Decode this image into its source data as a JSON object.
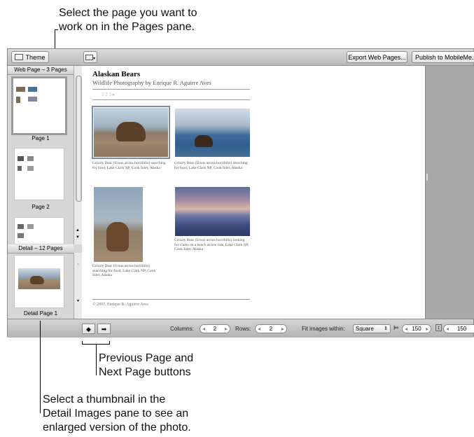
{
  "callouts": {
    "top_line1": "Select the page you want to",
    "top_line2": "work on in the Pages pane.",
    "nav_line1": "Previous Page and",
    "nav_line2": "Next Page buttons",
    "detail_line1": "Select a thumbnail in the",
    "detail_line2": "Detail Images pane to see an",
    "detail_line3": "enlarged version of the photo."
  },
  "toolbar": {
    "theme_label": "Theme",
    "export_label": "Export Web Pages...",
    "publish_label": "Publish to MobileMe..."
  },
  "pages_pane": {
    "header": "Web Page – 3 Pages",
    "items": [
      {
        "label": "Page 1"
      },
      {
        "label": "Page 2"
      }
    ]
  },
  "detail_pane": {
    "header": "Detail – 12 Pages",
    "items": [
      {
        "label": "Detail Page 1"
      }
    ]
  },
  "page": {
    "title": "Alaskan Bears",
    "subtitle": "Wildlife Photography by Enrique R. Aguirre Aves",
    "pagenav": "1 2 3 ▸",
    "footer": "© 2007, Enrique R. Aguirre Aves",
    "captions": [
      "Grizzly Bear (Ursus arctos horribilis) searching for food, Lake Clark NP, Cook Inlet, Alaska",
      "Grizzly Bear (Ursus arctos horribilis) searching for food, Lake Clark NP, Cook Inlet, Alaska",
      "Grizzly Bear (Ursus arctos horribilis) searching for food, Lake Clark NP, Cook Inlet, Alaska",
      "Grizzly Bear (Ursus arctos horribilis) looking for clams on a beach at low tide, Lake Clark NP, Cook Inlet, Alaska"
    ]
  },
  "bottombar": {
    "columns_label": "Columns:",
    "columns_value": "2",
    "rows_label": "Rows:",
    "rows_value": "2",
    "fit_label": "Fit images within:",
    "fit_value": "Square",
    "width_value": "150",
    "height_value": "150"
  }
}
